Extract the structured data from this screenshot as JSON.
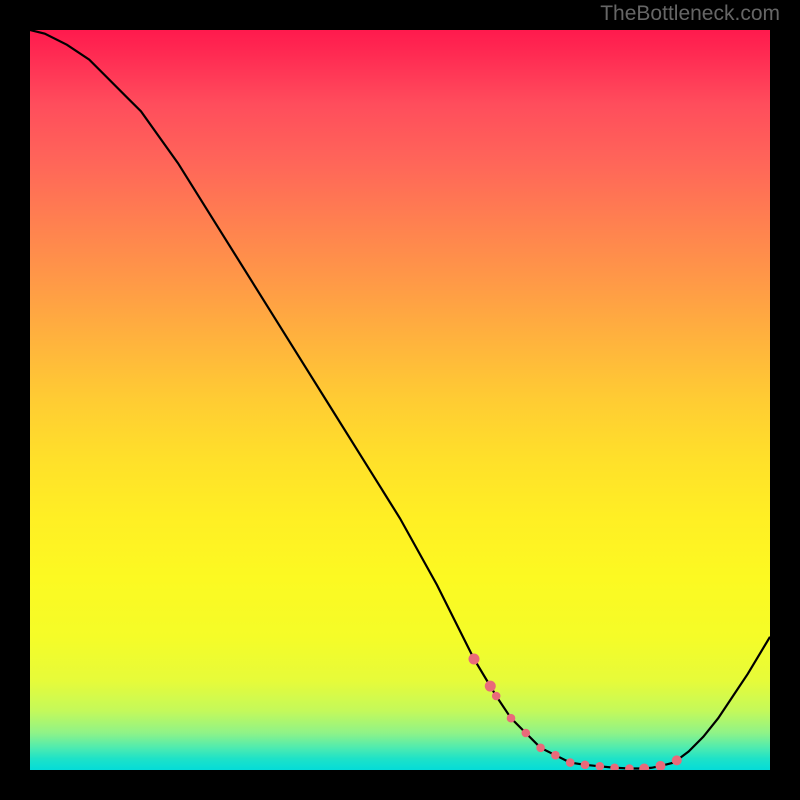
{
  "watermark": "TheBottleneck.com",
  "chart_data": {
    "type": "line",
    "title": "",
    "xlabel": "",
    "ylabel": "",
    "x": [
      0,
      2,
      5,
      8,
      10,
      15,
      20,
      25,
      30,
      35,
      40,
      45,
      50,
      55,
      60,
      63,
      65,
      67,
      69,
      71,
      73,
      75,
      77,
      79,
      81,
      82,
      83,
      84,
      85,
      87,
      89,
      91,
      93,
      95,
      97,
      100
    ],
    "values": [
      100,
      99.5,
      98,
      96,
      94,
      89,
      82,
      74,
      66,
      58,
      50,
      42,
      34,
      25,
      15,
      10,
      7,
      5,
      3,
      2,
      1,
      0.7,
      0.5,
      0.3,
      0.2,
      0.2,
      0.2,
      0.3,
      0.5,
      1,
      2.5,
      4.5,
      7,
      10,
      13,
      18
    ],
    "ylim": [
      0,
      100
    ],
    "xlim": [
      0,
      100
    ],
    "dotted_segments": [
      {
        "x_start": 60,
        "x_end": 63
      },
      {
        "x_start": 63,
        "x_end": 83
      },
      {
        "x_start": 83,
        "x_end": 88
      }
    ],
    "dot_color": "#e96a7a"
  }
}
